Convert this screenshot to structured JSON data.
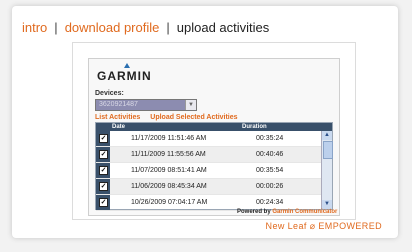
{
  "nav": {
    "intro": "intro",
    "sep1": "|",
    "download": "download profile",
    "sep2": "|",
    "upload": "upload activities"
  },
  "widget": {
    "logo": "GARMIN",
    "devices_label": "Devices:",
    "device_value": "3620921487",
    "device_arrow": "▼",
    "list_activities": "List Activities",
    "upload_selected": "Upload Selected Activities",
    "columns": {
      "date": "Date",
      "duration": "Duration"
    },
    "rows": [
      {
        "date": "11/17/2009 11:51:46 AM",
        "duration": "00:35:24",
        "checked": true
      },
      {
        "date": "11/11/2009 11:55:56 AM",
        "duration": "00:40:46",
        "checked": true
      },
      {
        "date": "11/07/2009 08:51:41 AM",
        "duration": "00:35:54",
        "checked": true
      },
      {
        "date": "11/06/2009 08:45:34 AM",
        "duration": "00:00:26",
        "checked": true
      },
      {
        "date": "10/26/2009 07:04:17 AM",
        "duration": "00:24:34",
        "checked": true
      }
    ],
    "powered_prefix": "Powered by",
    "powered_link": "Garmin Communicator"
  },
  "footer": {
    "brand": "New Leaf ⌀ EMPOWERED"
  },
  "colors": {
    "accent": "#e06a1f",
    "header": "#39506a"
  }
}
